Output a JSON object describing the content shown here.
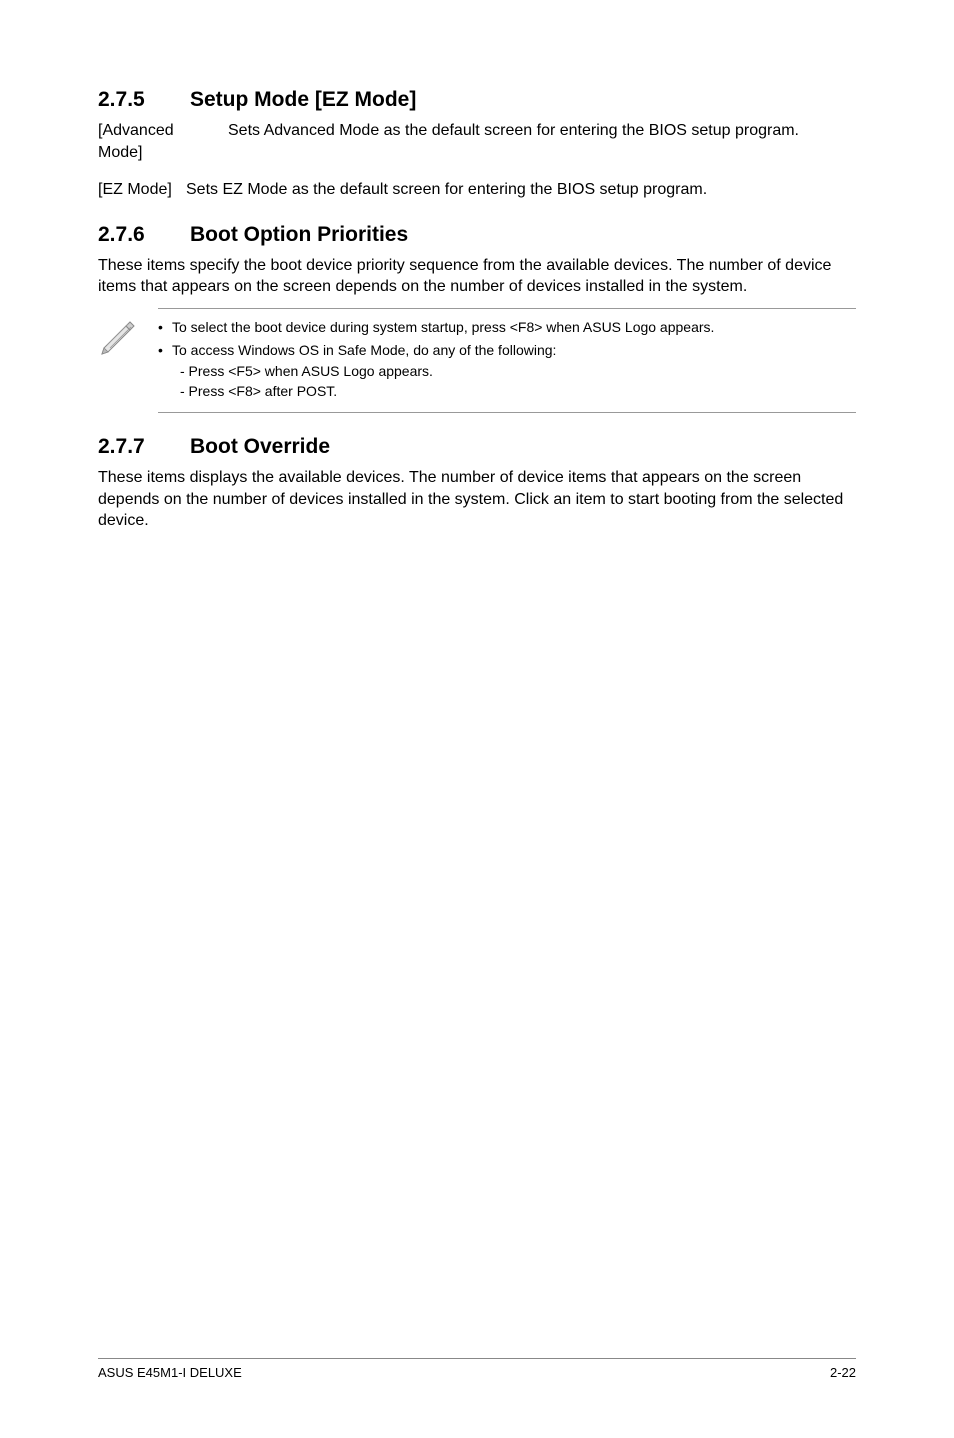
{
  "sections": {
    "s1": {
      "num": "2.7.5",
      "title": "Setup Mode [EZ Mode]",
      "defs": {
        "advanced": {
          "term": "[Advanced Mode]",
          "body": "Sets Advanced Mode as the default screen for entering the BIOS setup program."
        },
        "ez": {
          "term": "[EZ Mode]",
          "body": "Sets EZ Mode as the default screen for entering the BIOS setup program."
        }
      }
    },
    "s2": {
      "num": "2.7.6",
      "title": "Boot Option Priorities",
      "para": "These items specify the boot device priority sequence from the available devices. The number of device items that appears on the screen depends on the number of devices installed in the system.",
      "note": {
        "item1": "To select the boot device during system startup, press <F8> when ASUS Logo appears.",
        "item2_lead": "To access Windows OS in Safe Mode, do any of the following:",
        "item2_sub1": "- Press <F5> when ASUS Logo appears.",
        "item2_sub2": "- Press <F8> after POST."
      }
    },
    "s3": {
      "num": "2.7.7",
      "title": "Boot Override",
      "para": "These items displays the available devices. The number of device items that appears on the screen depends on the number of devices installed in the system. Click an item to start booting from the selected device."
    }
  },
  "footer": {
    "left": "ASUS E45M1-I DELUXE",
    "right": "2-22"
  }
}
